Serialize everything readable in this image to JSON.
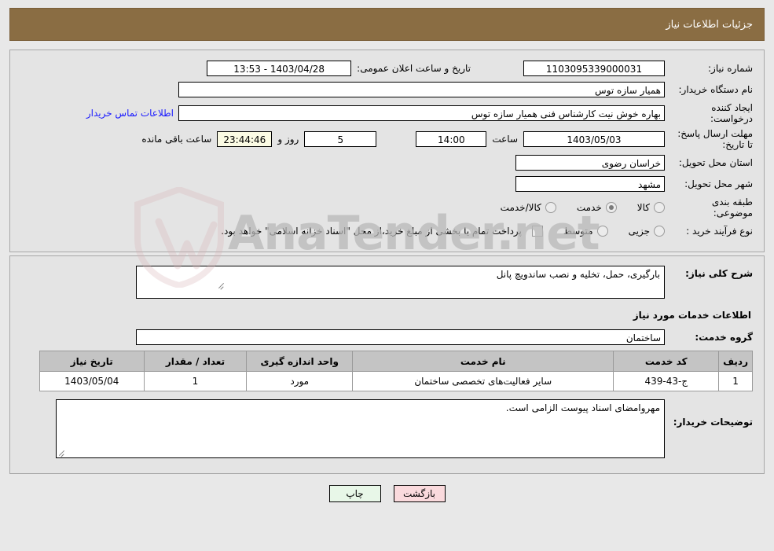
{
  "header": {
    "title": "جزئیات اطلاعات نیاز",
    "bar_color": "#8a6d43"
  },
  "watermark": {
    "text": "AnaTender.net"
  },
  "top_panel": {
    "need_number_label": "شماره نیاز:",
    "need_number_value": "1103095339000031",
    "announce_datetime_label": "تاریخ و ساعت اعلان عمومی:",
    "announce_datetime_value": "1403/04/28 - 13:53",
    "buyer_org_label": "نام دستگاه خریدار:",
    "buyer_org_value": "همیار سازه توس",
    "request_creator_label": "ایجاد کننده درخواست:",
    "request_creator_value": "بهاره خوش نیت کارشناس فنی همیار سازه توس",
    "contact_link": "اطلاعات تماس خریدار",
    "deadline_label": "مهلت ارسال پاسخ: تا تاریخ:",
    "deadline_date": "1403/05/03",
    "hour_label": "ساعت",
    "deadline_time": "14:00",
    "days_remaining": "5",
    "days_label": "روز و",
    "countdown": "23:44:46",
    "countdown_label": "ساعت باقی مانده",
    "province_label": "استان محل تحویل:",
    "province_value": "خراسان رضوی",
    "city_label": "شهر محل تحویل:",
    "city_value": "مشهد",
    "category_label": "طبقه بندی موضوعی:",
    "category_options": [
      {
        "label": "کالا",
        "selected": false
      },
      {
        "label": "خدمت",
        "selected": true
      },
      {
        "label": "کالا/خدمت",
        "selected": false
      }
    ],
    "process_label": "نوع فرآیند خرید :",
    "process_options": [
      {
        "label": "جزیی",
        "selected": false
      },
      {
        "label": "متوسط",
        "selected": false
      }
    ],
    "treasury_checkbox_checked": false,
    "treasury_note": "پرداخت تمام یا بخشی از مبلغ خرید،از محل \"اسناد خزانه اسلامی\" خواهد بود."
  },
  "bottom_panel": {
    "general_desc_label": "شرح کلی نیاز:",
    "general_desc_value": "بارگیری، حمل، تخلیه و نصب ساندویچ پانل",
    "services_info_title": "اطلاعات خدمات مورد نیاز",
    "service_group_label": "گروه خدمت:",
    "service_group_value": "ساختمان",
    "table": {
      "columns": [
        "ردیف",
        "کد خدمت",
        "نام خدمت",
        "واحد اندازه گیری",
        "تعداد / مقدار",
        "تاریخ نیاز"
      ],
      "rows": [
        {
          "radif": "1",
          "code": "ج-43-439",
          "name": "سایر فعالیت‌های تخصصی ساختمان",
          "unit": "مورد",
          "quantity": "1",
          "date": "1403/05/04"
        }
      ]
    },
    "buyer_notes_label": "توضیحات خریدار:",
    "buyer_notes_value": "مهروامضای اسناد پیوست الزامی است."
  },
  "buttons": {
    "print": "چاپ",
    "back": "بازگشت"
  }
}
